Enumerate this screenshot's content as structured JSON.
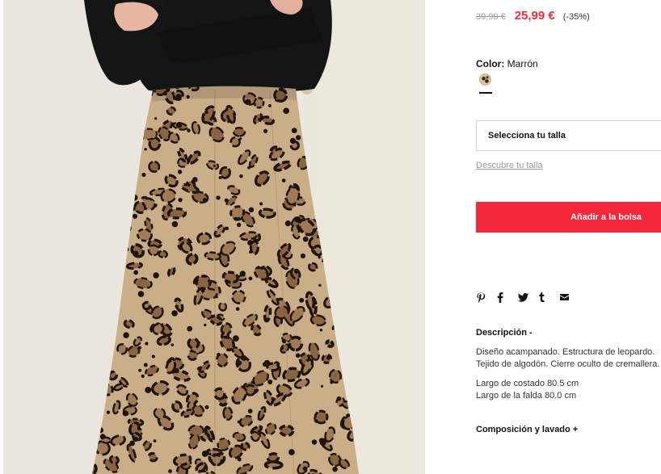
{
  "product": {
    "old_price": "39,99 €",
    "new_price": "25,99 €",
    "discount": "(-35%)",
    "color_label": "Color:",
    "color_value": "Marrón",
    "size_placeholder": "Selecciona tu talla",
    "size_guide": "Descubre tu talla",
    "add_to_bag": "Añadir a la bolsa"
  },
  "share_icons": [
    "pinterest-icon",
    "facebook-icon",
    "twitter-icon",
    "tumblr-icon",
    "email-icon"
  ],
  "description": {
    "title": "Descripción -",
    "lines": [
      "Diseño acampanado. Estructura de leopardo.",
      "Tejido de algodón. Cierre oculto de cremallera."
    ],
    "measures": [
      "Largo de costado 80.5 cm",
      "Largo de la falda 80.0 cm"
    ]
  },
  "composition": {
    "title": "Composición y lavado +"
  },
  "colors": {
    "accent": "#f5273a",
    "price_sale": "#ed2f3a"
  }
}
